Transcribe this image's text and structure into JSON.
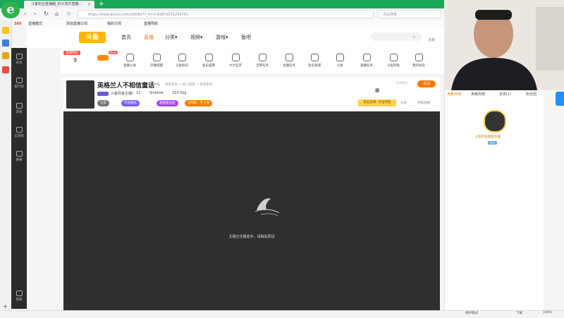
{
  "browser": {
    "tab_title": "斗鱼钓业直播圈_钓斗音乐直播...",
    "tab_close": "×",
    "tab_new": "+",
    "url": "https://www.douyu.com/10081??_rt=0.42875075204741",
    "search_placeholder": "点此搜索",
    "nav": {
      "back": "‹",
      "forward": "›",
      "reload": "↻",
      "home": "⌂",
      "bookmark": "☆"
    },
    "bookmarks": [
      "直播模式",
      "添加直播订阅",
      "我的订阅",
      "直播导航"
    ],
    "mode_label": "360"
  },
  "site": {
    "logo": "斗鱼",
    "nav": [
      "首页",
      "直播",
      "分类▾",
      "视频▾",
      "游戏▾",
      "鱼吧"
    ],
    "history_label": "历史",
    "sidebar": [
      "关注",
      "排行榜",
      "游戏",
      "云游戏",
      "赛事",
      "客服"
    ],
    "categories": [
      "直播开关",
      "直播技术",
      "直播公会",
      "开播提醒",
      "斗鱼快讯",
      "鱼乐盛典",
      "主播任务",
      "大力全开",
      "全网任务",
      "主播认证",
      "鱼乐商城",
      "公会",
      "直播任务",
      "斗鱼钓鱼",
      "我的动态"
    ],
    "level_badge": "9",
    "level_label": "直播特权",
    "new_badge": "New"
  },
  "room": {
    "title": "英格兰人不相信童话",
    "meta": [
      "举报",
      "网游竞技 > 格斗游戏 > 拳皇系列"
    ],
    "host": "斗鱼钓鱼主播",
    "hot": "12",
    "shadow": "Shadow",
    "fans": "210.5kg",
    "follow_label": "关注",
    "follow_count": "1165%",
    "tags": [
      "分享",
      "钓鱼精选",
      "超级粉丝团",
      "分时段 · 不上榜"
    ],
    "ad_label": "欢迎您来: 点击参加",
    "share_label": "分享",
    "report_label": "举报直播"
  },
  "player": {
    "offline_text": "主播正在路途中，请稍后再试"
  },
  "right_panel": {
    "tabs": [
      "贡献日榜",
      "贡献周榜",
      "贵宾(1)",
      "粉丝团"
    ],
    "user_name": "斗鱼钓鱼超级主播",
    "user_level": "LV1"
  },
  "status": {
    "left": "",
    "right_items": [
      "保护模式",
      "下载",
      "100%"
    ]
  },
  "colors": {
    "tabbar": "#1aa85a",
    "brand": "#ff7700",
    "player_bg": "#2f2f2f"
  }
}
